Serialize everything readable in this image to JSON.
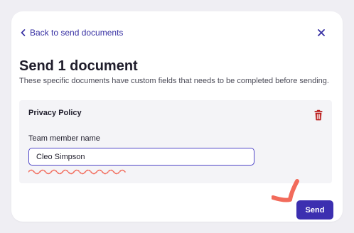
{
  "modal": {
    "back_label": "Back to send documents",
    "title": "Send 1 document",
    "subtitle": "These specific documents have custom fields that needs to be completed before sending."
  },
  "document": {
    "name": "Privacy Policy",
    "field": {
      "label": "Team member name",
      "value": "Cleo Simpson"
    }
  },
  "actions": {
    "send_label": "Send"
  },
  "icons": {
    "back": "chevron-left-icon",
    "close": "close-icon",
    "delete": "trash-icon"
  },
  "colors": {
    "accent": "#3c2fb0",
    "link": "#3730a3",
    "danger": "#b91c1c",
    "annotation": "#f26b5b"
  }
}
